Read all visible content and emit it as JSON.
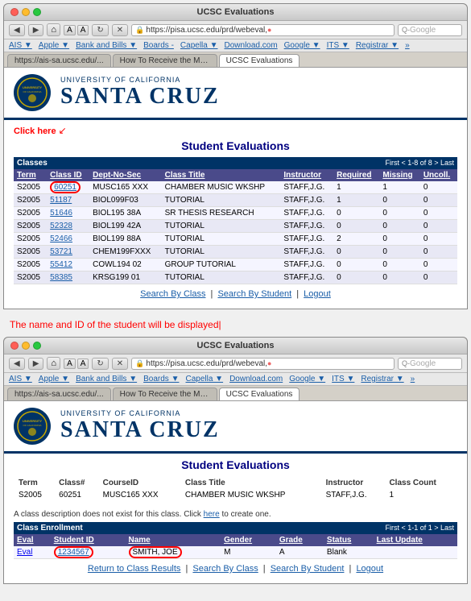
{
  "page": {
    "title": "UCSC Evaluations"
  },
  "browser1": {
    "title": "UCSC Evaluations",
    "url": "https://pisa.ucsc.edu/prd/webeval,",
    "search_placeholder": "Google",
    "bookmarks": [
      "AIS ▼",
      "Apple ▼",
      "Bank and Bills ▼",
      "Boards ▼",
      "Capella ▼",
      "Download.com",
      "Google ▼",
      "ITS ▼",
      "Registrar ▼",
      "»"
    ],
    "tabs": [
      {
        "label": "https://ais-sa.ucsc.edu/...",
        "active": false
      },
      {
        "label": "How To Receive the Mat...",
        "active": false
      },
      {
        "label": "UCSC Evaluations",
        "active": true
      }
    ],
    "click_here_label": "Click here",
    "section_title": "Student Evaluations",
    "table_section_title": "Classes",
    "pagination": "First  1-8 of 8  Last",
    "columns": [
      "Term",
      "Class ID",
      "Dept-No-Sec",
      "Class Title",
      "Instructor",
      "Required",
      "Missing",
      "Uncoll."
    ],
    "rows": [
      {
        "term": "S2005",
        "class_id": "60251",
        "dept": "MUSC165 XXX",
        "title": "CHAMBER MUSIC WKSHP",
        "instructor": "STAFF,J.G.",
        "required": "1",
        "missing": "1",
        "uncoll": "0"
      },
      {
        "term": "S2005",
        "class_id": "51187",
        "dept": "BIOL099F03",
        "title": "TUTORIAL",
        "instructor": "STAFF,J.G.",
        "required": "1",
        "missing": "0",
        "uncoll": "0"
      },
      {
        "term": "S2005",
        "class_id": "51646",
        "dept": "BIOL195 38A",
        "title": "SR THESIS RESEARCH",
        "instructor": "STAFF,J.G.",
        "required": "0",
        "missing": "0",
        "uncoll": "0"
      },
      {
        "term": "S2005",
        "class_id": "52328",
        "dept": "BIOL199 42A",
        "title": "TUTORIAL",
        "instructor": "STAFF,J.G.",
        "required": "0",
        "missing": "0",
        "uncoll": "0"
      },
      {
        "term": "S2005",
        "class_id": "52466",
        "dept": "BIOL199 88A",
        "title": "TUTORIAL",
        "instructor": "STAFF,J.G.",
        "required": "2",
        "missing": "0",
        "uncoll": "0"
      },
      {
        "term": "S2005",
        "class_id": "53721",
        "dept": "CHEM199FXXX",
        "title": "TUTORIAL",
        "instructor": "STAFF,J.G.",
        "required": "0",
        "missing": "0",
        "uncoll": "0"
      },
      {
        "term": "S2005",
        "class_id": "55412",
        "dept": "COWL194 02",
        "title": "GROUP TUTORIAL",
        "instructor": "STAFF,J.G.",
        "required": "0",
        "missing": "0",
        "uncoll": "0"
      },
      {
        "term": "S2005",
        "class_id": "58385",
        "dept": "KRSG199 01",
        "title": "TUTORIAL",
        "instructor": "STAFF,J.G.",
        "required": "0",
        "missing": "0",
        "uncoll": "0"
      }
    ],
    "nav_links": [
      "Search By Class",
      "Search By Student",
      "Logout"
    ]
  },
  "instruction": "The name and ID of the student will be displayed|",
  "browser2": {
    "title": "UCSC Evaluations",
    "url": "https://pisa.ucsc.edu/prd/webeval,",
    "search_placeholder": "Google",
    "bookmarks": [
      "AIS ▼",
      "Apple ▼",
      "Bank and Bills ▼",
      "Boards ▼",
      "Capella ▼",
      "Download.com",
      "Google ▼",
      "ITS ▼",
      "Registrar ▼",
      "»"
    ],
    "tabs": [
      {
        "label": "https://ais-sa.ucsc.edu/...",
        "active": false
      },
      {
        "label": "How To Receive the Mat...",
        "active": false
      },
      {
        "label": "UCSC Evaluations",
        "active": true
      }
    ],
    "section_title": "Student Evaluations",
    "class_info": {
      "columns": [
        "Term",
        "Class#",
        "CourseID",
        "Class Title",
        "Instructor",
        "Class Count"
      ],
      "row": [
        "S2005",
        "60251",
        "MUSC165 XXX",
        "CHAMBER MUSIC WKSHP",
        "STAFF,J.G.",
        "1"
      ]
    },
    "class_desc": "A class description does not exist for this class. Click",
    "class_desc_link": "here",
    "class_desc_end": "to create one.",
    "enrollment_section": "Class Enrollment",
    "enrollment_pagination": "First  1-1 of 1  Last",
    "enrollment_columns": [
      "Eval",
      "Student ID",
      "Name",
      "Gender",
      "Grade",
      "Status",
      "Last Update"
    ],
    "enrollment_rows": [
      {
        "eval": "Eval",
        "student_id": "1234567",
        "name": "SMITH, JOE",
        "gender": "M",
        "grade": "A",
        "status": "Blank",
        "last_update": ""
      }
    ],
    "nav_links": [
      "Return to Class Results",
      "Search By Class",
      "Search By Student",
      "Logout"
    ]
  },
  "ucsc": {
    "subtitle": "UNIVERSITY OF CALIFORNIA",
    "title": "SANTA CRUZ"
  }
}
